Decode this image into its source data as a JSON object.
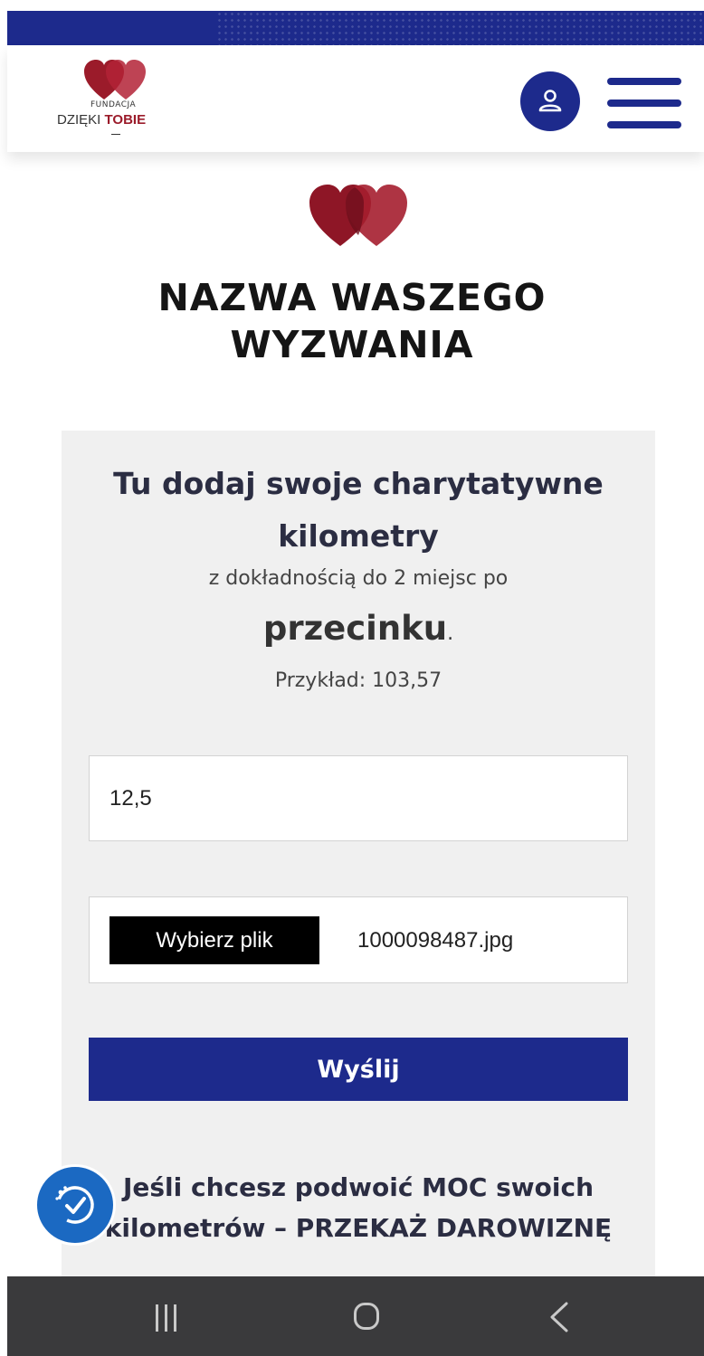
{
  "header": {
    "logo_small": "FUNDACJA",
    "logo_main": "DZIĘKI",
    "logo_accent": "TOBIE",
    "user_icon": "user-icon",
    "menu_icon": "hamburger-menu-icon"
  },
  "hero": {
    "icon": "hearts-icon",
    "title_line1": "NAZWA WASZEGO",
    "title_line2": "WYZWANIA"
  },
  "form": {
    "heading_line1": "Tu dodaj swoje charytatywne",
    "heading_line2": "kilometry",
    "subtext": "z dokładnością do 2 miejsc po",
    "emphasis": "przecinku",
    "period": ".",
    "example": "Przykład: 103,57",
    "km_value": "12,5",
    "file_button": "Wybierz plik",
    "file_name": "1000098487.jpg",
    "submit": "Wyślij"
  },
  "promo": {
    "line1": "Jeśli chcesz podwoić MOC swoich",
    "line2": "kilometrów – PRZEKAŻ DAROWIZNĘ"
  },
  "accessibility": {
    "icon": "accessibility-icon"
  },
  "colors": {
    "brand_blue": "#1d2a8c",
    "heart_red": "#9b1b2a",
    "accessibility_blue": "#1b69c2"
  }
}
